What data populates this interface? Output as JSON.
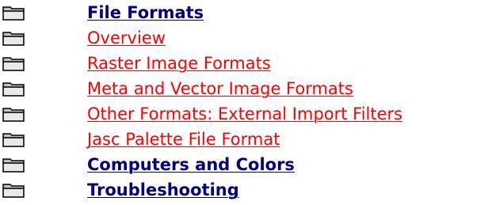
{
  "colors": {
    "heading_link": "#000080",
    "topic_link": "#ff0000",
    "folder_fill": "#c0c0c0",
    "folder_outline": "#000000"
  },
  "icons": {
    "folder": "closed-book-folder-icon"
  },
  "toc": {
    "items": [
      {
        "label": "File Formats",
        "style": "heading"
      },
      {
        "label": "Overview",
        "style": "topic"
      },
      {
        "label": "Raster Image Formats",
        "style": "topic"
      },
      {
        "label": "Meta and Vector Image Formats",
        "style": "topic"
      },
      {
        "label": "Other Formats: External Import Filters",
        "style": "topic"
      },
      {
        "label": "Jasc Palette File Format",
        "style": "topic"
      },
      {
        "label": "Computers and Colors",
        "style": "heading"
      },
      {
        "label": "Troubleshooting",
        "style": "heading"
      }
    ]
  }
}
